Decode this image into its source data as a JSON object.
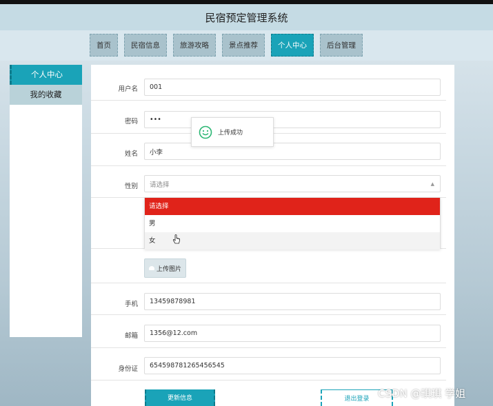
{
  "header": {
    "title": "民宿预定管理系统"
  },
  "nav": {
    "items": [
      {
        "label": "首页",
        "active": false
      },
      {
        "label": "民宿信息",
        "active": false
      },
      {
        "label": "旅游攻略",
        "active": false
      },
      {
        "label": "景点推荐",
        "active": false
      },
      {
        "label": "个人中心",
        "active": true
      },
      {
        "label": "后台管理",
        "active": false
      }
    ]
  },
  "sidebar": {
    "items": [
      {
        "label": "个人中心",
        "active": true
      },
      {
        "label": "我的收藏",
        "active": false
      }
    ]
  },
  "form": {
    "username": {
      "label": "用户名",
      "value": "001"
    },
    "password": {
      "label": "密码",
      "value": "•••"
    },
    "name": {
      "label": "姓名",
      "value": "小李"
    },
    "gender": {
      "label": "性别",
      "placeholder": "请选择",
      "options": [
        "请选择",
        "男",
        "女"
      ],
      "selected": "请选择"
    },
    "upload": {
      "label": "上传图片"
    },
    "phone": {
      "label": "手机",
      "value": "13459878981"
    },
    "email": {
      "label": "邮箱",
      "value": "1356@12.com"
    },
    "idcard": {
      "label": "身份证",
      "value": "654598781265456545"
    }
  },
  "toast": {
    "text": "上传成功"
  },
  "buttons": {
    "update": "更新信息",
    "logout": "退出登录"
  },
  "watermark": "CSDN @琪琪 学姐",
  "colors": {
    "accent": "#1aa3b8",
    "selected": "#e0231a",
    "toast_icon": "#2bb673"
  }
}
